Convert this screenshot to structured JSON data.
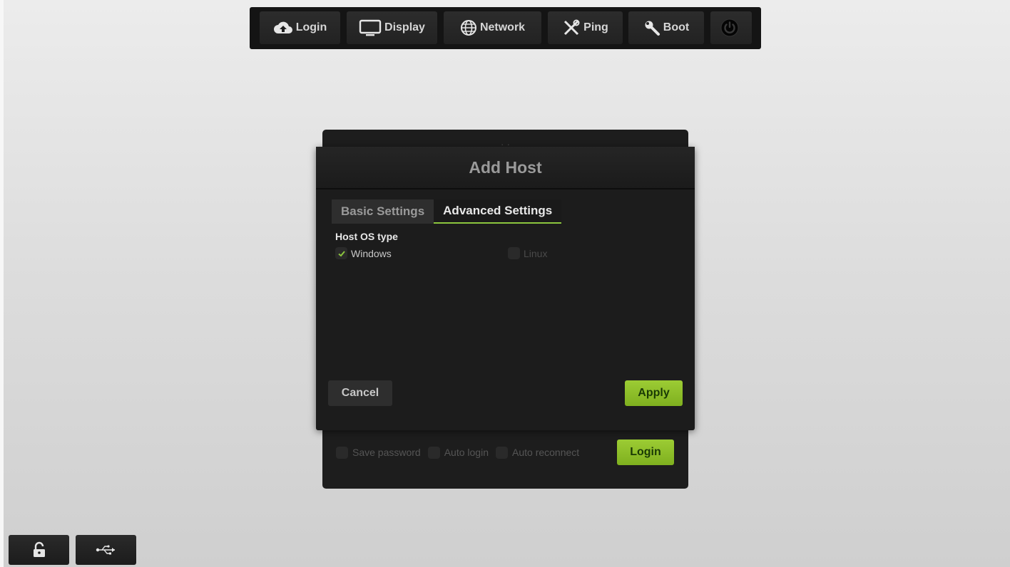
{
  "toolbar": {
    "login": "Login",
    "display": "Display",
    "network": "Network",
    "ping": "Ping",
    "boot": "Boot"
  },
  "dialog": {
    "title": "Add Host",
    "tabs": [
      "Basic Settings",
      "Advanced Settings"
    ],
    "active_tab": "Advanced Settings",
    "section_label": "Host OS type",
    "os_options": [
      {
        "label": "Windows",
        "checked": true
      },
      {
        "label": "Linux",
        "checked": false
      }
    ],
    "cancel": "Cancel",
    "apply": "Apply"
  },
  "login_panel": {
    "save_password": "Save password",
    "auto_login": "Auto login",
    "auto_reconnect": "Auto reconnect",
    "login_button": "Login"
  },
  "colors": {
    "accent_green": "#8cc63e",
    "toolbar_bg": "#141414",
    "dialog_bg": "#1c1c1c"
  },
  "icons": {
    "login": "cloud-upload-icon",
    "display": "monitor-icon",
    "network": "globe-icon",
    "ping": "tools-icon",
    "boot": "wrench-icon",
    "power": "power-icon",
    "lock": "lock-icon",
    "usb": "usb-icon"
  }
}
